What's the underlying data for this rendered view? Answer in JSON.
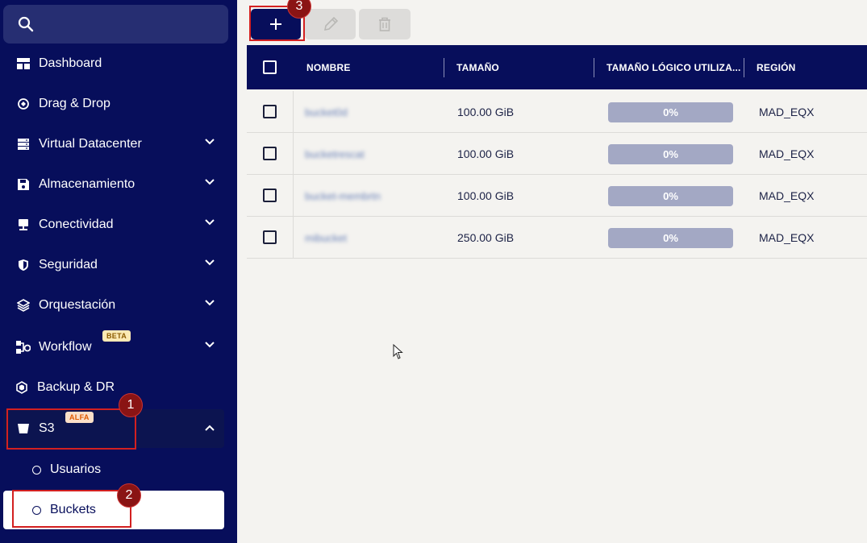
{
  "sidebar": {
    "search_placeholder": "",
    "items": [
      {
        "label": "Dashboard",
        "icon": "dashboard-icon"
      },
      {
        "label": "Drag & Drop",
        "icon": "drag-drop-icon"
      },
      {
        "label": "Virtual Datacenter",
        "icon": "server-icon"
      },
      {
        "label": "Almacenamiento",
        "icon": "save-icon"
      },
      {
        "label": "Conectividad",
        "icon": "monitor-icon"
      },
      {
        "label": "Seguridad",
        "icon": "shield-icon"
      },
      {
        "label": "Orquestación",
        "icon": "layers-icon"
      },
      {
        "label": "Workflow",
        "icon": "workflow-icon",
        "badge": "BETA"
      },
      {
        "label": "Backup & DR",
        "icon": "backup-icon"
      },
      {
        "label": "S3",
        "icon": "bucket-icon",
        "badge": "ALFA"
      }
    ],
    "s3_sub": [
      {
        "label": "Usuarios"
      },
      {
        "label": "Buckets"
      }
    ]
  },
  "steps": [
    "1",
    "2",
    "3"
  ],
  "table": {
    "columns": [
      "NOMBRE",
      "TAMAÑO",
      "TAMAÑO LÓGICO UTILIZA...",
      "REGIÓN"
    ],
    "rows": [
      {
        "name": "bucket0d",
        "size": "100.00 GiB",
        "usage": "0%",
        "region": "MAD_EQX"
      },
      {
        "name": "bucketrescat",
        "size": "100.00 GiB",
        "usage": "0%",
        "region": "MAD_EQX"
      },
      {
        "name": "bucket-membrtn",
        "size": "100.00 GiB",
        "usage": "0%",
        "region": "MAD_EQX"
      },
      {
        "name": "mibucket",
        "size": "250.00 GiB",
        "usage": "0%",
        "region": "MAD_EQX"
      }
    ]
  },
  "colors": {
    "navy": "#070e5b",
    "highlight": "#d32020",
    "progress": "#a3a8c4"
  }
}
